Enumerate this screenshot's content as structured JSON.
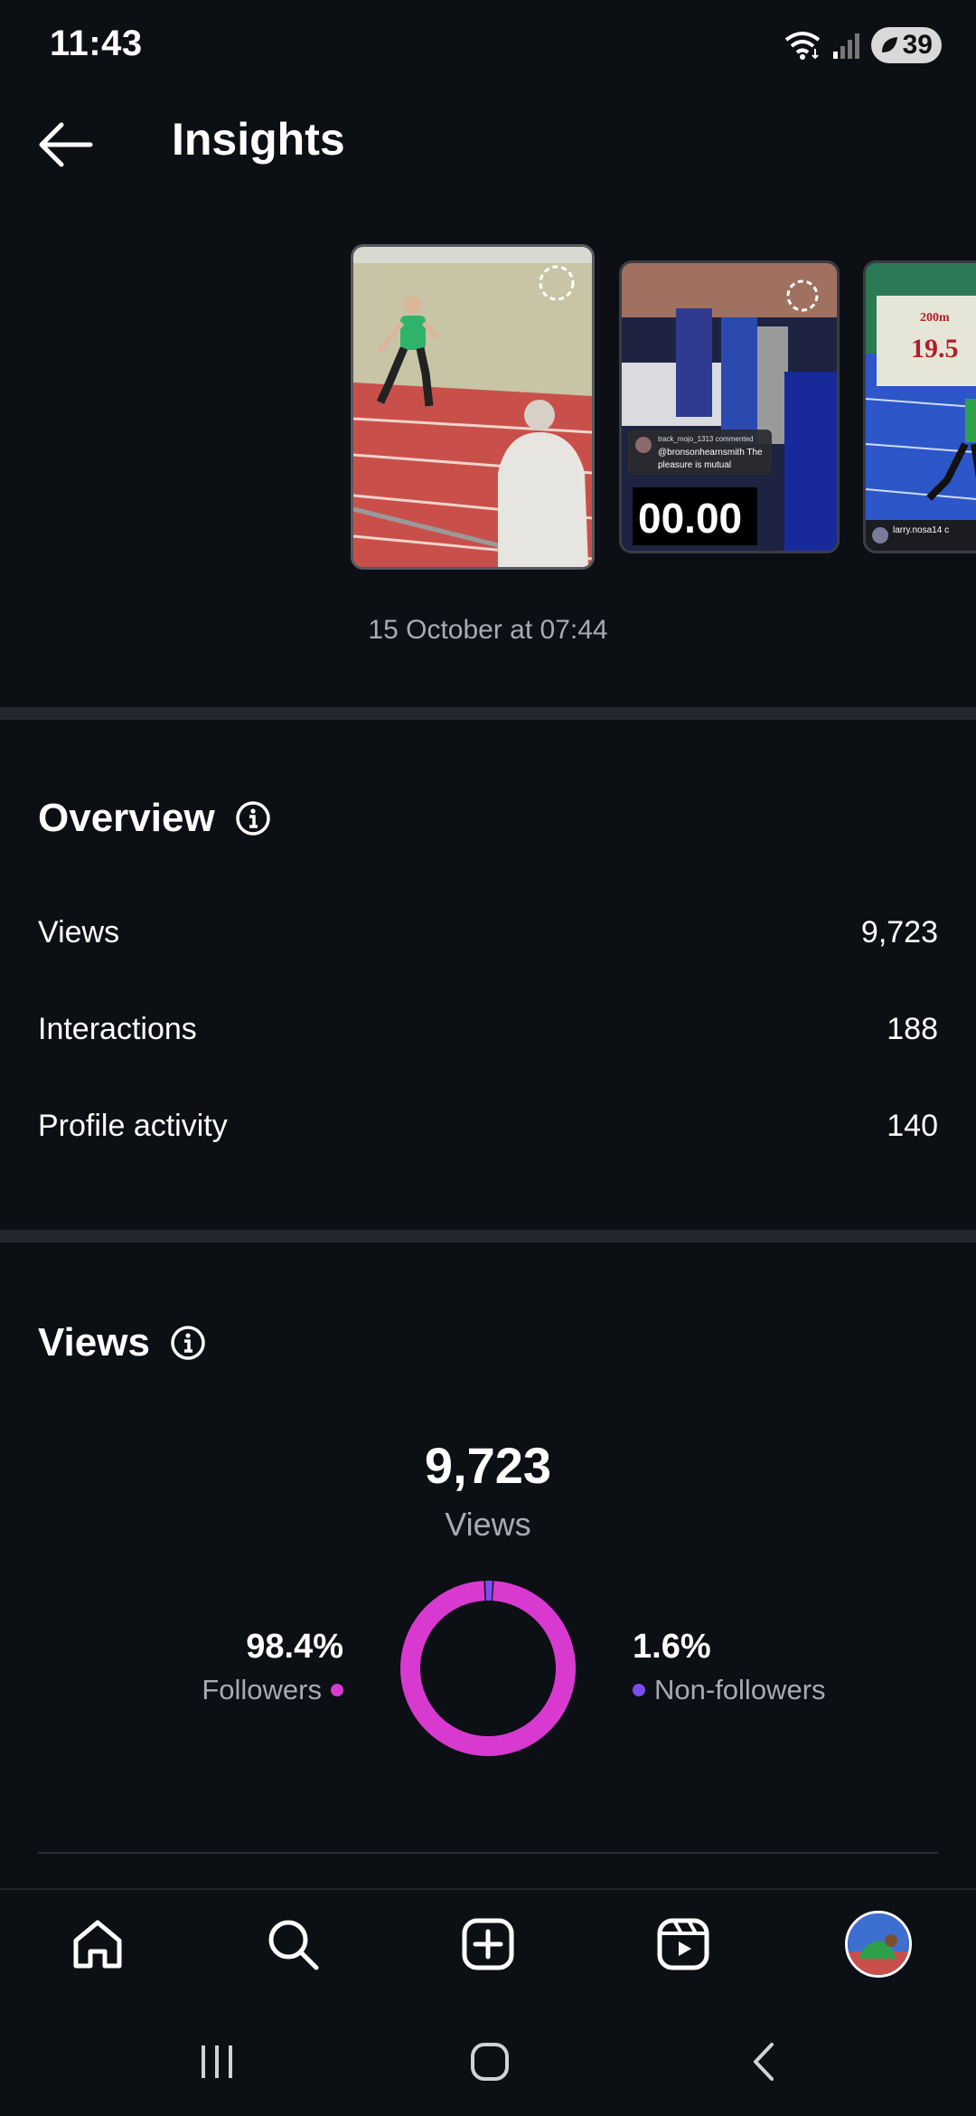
{
  "status_bar": {
    "time": "11:43",
    "battery": "39"
  },
  "header": {
    "title": "Insights"
  },
  "post": {
    "date": "15 October at 07:44",
    "thumb2_comment_user": "track_mojo_1313 commented",
    "thumb2_comment_text": "@bronsonhearnsmith The pleasure is mutual",
    "thumb2_timer": "00.00",
    "thumb3_board_top": "200m",
    "thumb3_board_value": "19.5",
    "thumb3_user": "larry.nosa14 c"
  },
  "overview": {
    "title": "Overview",
    "rows": [
      {
        "label": "Views",
        "value": "9,723"
      },
      {
        "label": "Interactions",
        "value": "188"
      },
      {
        "label": "Profile activity",
        "value": "140"
      }
    ]
  },
  "views": {
    "title": "Views",
    "total": "9,723",
    "total_label": "Views",
    "followers_pct": "98.4%",
    "followers_label": "Followers",
    "nonfollowers_pct": "1.6%",
    "nonfollowers_label": "Non-followers"
  },
  "chart_data": {
    "type": "pie",
    "categories": [
      "Followers",
      "Non-followers"
    ],
    "values": [
      98.4,
      1.6
    ],
    "colors": [
      "#d83ad0",
      "#7a4df0"
    ],
    "title": "9,723"
  },
  "colors": {
    "background": "#0c0f14",
    "followers": "#d83ad0",
    "nonfollowers": "#7a4df0"
  },
  "icons": {
    "nav": [
      "home-icon",
      "search-icon",
      "create-icon",
      "reels-icon",
      "profile-avatar"
    ],
    "system": [
      "recent-apps-icon",
      "home-button-icon",
      "back-nav-icon"
    ]
  }
}
